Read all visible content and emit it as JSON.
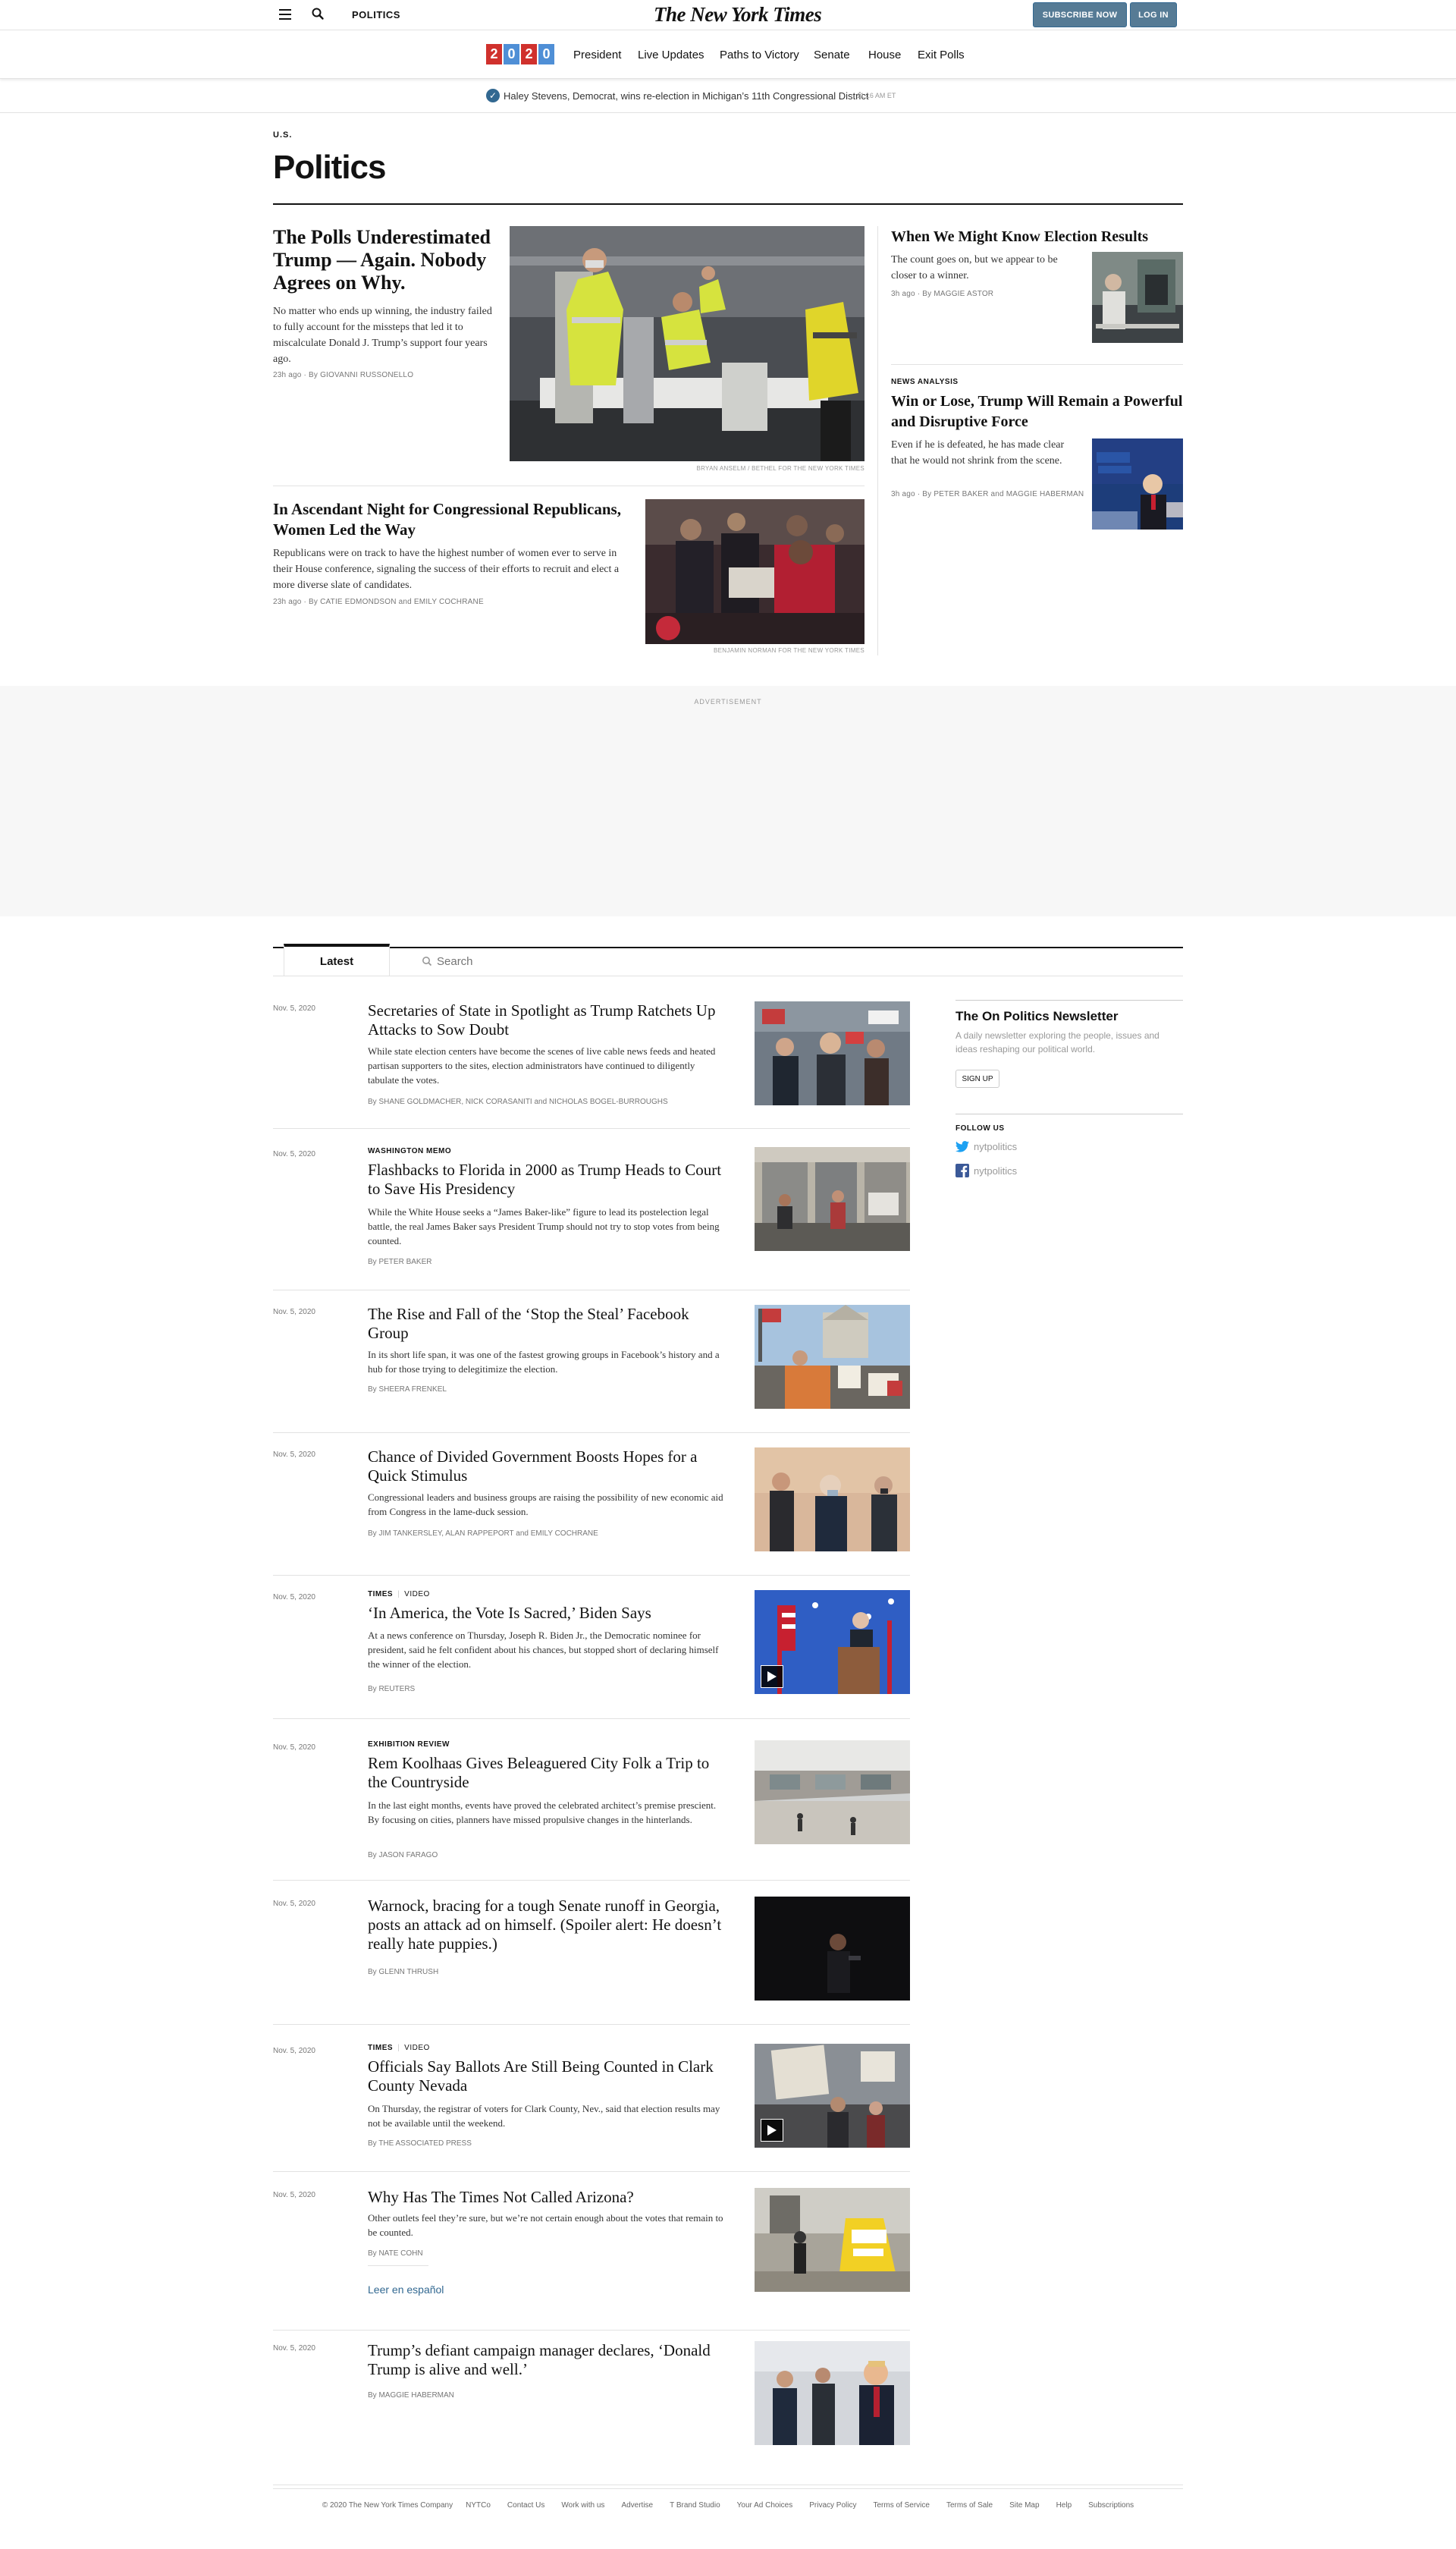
{
  "header": {
    "section": "POLITICS",
    "logo": "The New York Times",
    "subscribe": "SUBSCRIBE NOW",
    "login": "LOG IN"
  },
  "election_nav": {
    "digits": [
      "2",
      "0",
      "2",
      "0"
    ],
    "digit_colors": [
      "#d0312d",
      "#4f8fd6",
      "#d0312d",
      "#4f8fd6"
    ],
    "items": [
      "President",
      "Live Updates",
      "Paths to Victory",
      "Senate",
      "House",
      "Exit Polls"
    ]
  },
  "live_bar": {
    "text": "Haley Stevens, Democrat, wins re-election in Michigan’s 11th Congressional District",
    "time": "11:16 AM ET"
  },
  "section": {
    "kicker": "U.S.",
    "title": "Politics"
  },
  "top_stories": {
    "lead": {
      "headline": "The Polls Underestimated Trump — Again. Nobody Agrees on Why.",
      "summary": "No matter who ends up winning, the industry failed to fully account for the missteps that led it to miscalculate Donald J. Trump’s support four years ago.",
      "meta": "23h ago · By GIOVANNI RUSSONELLO",
      "credit": "BRYAN ANSELM / BETHEL FOR THE NEW YORK TIMES"
    },
    "second": {
      "headline": "In Ascendant Night for Congressional Republicans, Women Led the Way",
      "summary": "Republicans were on track to have the highest number of women ever to serve in their House conference, signaling the success of their efforts to recruit and elect a more diverse slate of candidates.",
      "meta": "23h ago · By CATIE EDMONDSON and EMILY COCHRANE",
      "credit": "BENJAMIN NORMAN FOR THE NEW YORK TIMES"
    },
    "right1": {
      "headline": "When We Might Know Election Results",
      "summary": "The count goes on, but we appear to be closer to a winner.",
      "meta": "3h ago · By MAGGIE ASTOR"
    },
    "right2": {
      "kicker": "NEWS ANALYSIS",
      "headline": "Win or Lose, Trump Will Remain a Powerful and Disruptive Force",
      "summary": "Even if he is defeated, he has made clear that he would not shrink from the scene.",
      "meta": "3h ago · By PETER BAKER and MAGGIE HABERMAN"
    }
  },
  "ad": {
    "label": "ADVERTISEMENT"
  },
  "tabs": {
    "latest": "Latest",
    "search_placeholder": "Search"
  },
  "stories": [
    {
      "date": "Nov. 5, 2020",
      "kicker": "",
      "headline": "Secretaries of State in Spotlight as Trump Ratchets Up Attacks to Sow Doubt",
      "summary": "While state election centers have become the scenes of live cable news feeds and heated partisan supporters to the sites, election administrators have continued to diligently tabulate the votes.",
      "byline": "By SHANE GOLDMACHER, NICK CORASANITI and NICHOLAS BOGEL-BURROUGHS"
    },
    {
      "date": "Nov. 5, 2020",
      "kicker": "WASHINGTON MEMO",
      "headline": "Flashbacks to Florida in 2000 as Trump Heads to Court to Save His Presidency",
      "summary": "While the White House seeks a “James Baker-like” figure to lead its postelection legal battle, the real James Baker says President Trump should not try to stop votes from being counted.",
      "byline": "By PETER BAKER"
    },
    {
      "date": "Nov. 5, 2020",
      "kicker": "",
      "headline": "The Rise and Fall of the ‘Stop the Steal’ Facebook Group",
      "summary": "In its short life span, it was one of the fastest growing groups in Facebook’s history and a hub for those trying to delegitimize the election.",
      "byline": "By SHEERA FRENKEL"
    },
    {
      "date": "Nov. 5, 2020",
      "kicker": "",
      "headline": "Chance of Divided Government Boosts Hopes for a Quick Stimulus",
      "summary": "Congressional leaders and business groups are raising the possibility of new economic aid from Congress in the lame-duck session.",
      "byline": "By JIM TANKERSLEY, ALAN RAPPEPORT and EMILY COCHRANE"
    },
    {
      "date": "Nov. 5, 2020",
      "kicker": "TIMES",
      "kicker2": "VIDEO",
      "headline": "‘In America, the Vote Is Sacred,’ Biden Says",
      "summary": "At a news conference on Thursday, Joseph R. Biden Jr., the Democratic nominee for president, said he felt confident about his chances, but stopped short of declaring himself the winner of the election.",
      "byline": "By REUTERS"
    },
    {
      "date": "Nov. 5, 2020",
      "kicker": "EXHIBITION REVIEW",
      "headline": "Rem Koolhaas Gives Beleaguered City Folk a Trip to the Countryside",
      "summary": "In the last eight months, events have proved the celebrated architect’s premise prescient. By focusing on cities, planners have missed propulsive changes in the hinterlands.",
      "byline": "By JASON FARAGO"
    },
    {
      "date": "Nov. 5, 2020",
      "kicker": "",
      "headline": "Warnock, bracing for a tough Senate runoff in Georgia, posts an attack ad on himself. (Spoiler alert: He doesn’t really hate puppies.)",
      "summary": "",
      "byline": "By GLENN THRUSH"
    },
    {
      "date": "Nov. 5, 2020",
      "kicker": "TIMES",
      "kicker2": "VIDEO",
      "headline": "Officials Say Ballots Are Still Being Counted in Clark County Nevada",
      "summary": "On Thursday, the registrar of voters for Clark County, Nev., said that election results may not be available until the weekend.",
      "byline": "By THE ASSOCIATED PRESS"
    },
    {
      "date": "Nov. 5, 2020",
      "kicker": "",
      "headline": "Why Has The Times Not Called Arizona?",
      "summary": "Other outlets feel they’re sure, but we’re not certain enough about the votes that remain to be counted.",
      "byline": "By NATE COHN",
      "link": "Leer en español"
    },
    {
      "date": "Nov. 5, 2020",
      "kicker": "",
      "headline": "Trump’s defiant campaign manager declares, ‘Donald Trump is alive and well.’",
      "summary": "",
      "byline": "By MAGGIE HABERMAN"
    }
  ],
  "sidebar": {
    "newsletter_title": "The On Politics Newsletter",
    "newsletter_desc": "A daily newsletter exploring the people, issues and ideas reshaping our political world.",
    "signup": "SIGN UP",
    "follow_label": "FOLLOW US",
    "twitter": "nytpolitics",
    "facebook": "nytpolitics"
  },
  "footer": {
    "copyright": "© 2020 The New York Times Company",
    "links": [
      "NYTCo",
      "Contact Us",
      "Work with us",
      "Advertise",
      "T Brand Studio",
      "Your Ad Choices",
      "Privacy Policy",
      "Terms of Service",
      "Terms of Sale",
      "Site Map",
      "Help",
      "Subscriptions"
    ]
  }
}
